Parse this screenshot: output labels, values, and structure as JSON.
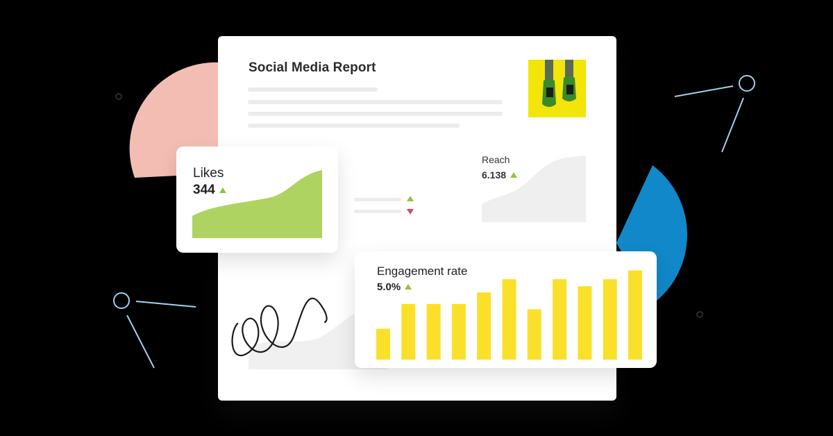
{
  "report": {
    "title": "Social Media Report"
  },
  "reach": {
    "label": "Reach",
    "value": "6.138",
    "trend": "up"
  },
  "likes": {
    "label": "Likes",
    "value": "344",
    "trend": "up"
  },
  "engagement": {
    "label": "Engagement rate",
    "value": "5.0%",
    "trend": "up"
  },
  "colors": {
    "likes_fill": "#aed361",
    "bar_fill": "#fbe02b",
    "trend_up": "#8cc63f",
    "trend_down": "#e0455a",
    "deco_pink": "#f4bdb4",
    "deco_blue": "#1188c9",
    "deco_line": "#9fd3ee"
  },
  "chart_data": {
    "type": "bar",
    "values": [
      3.5,
      6.3,
      6.3,
      6.3,
      7.6,
      9.1,
      5.7,
      9.1,
      8.3,
      9.1,
      10.1
    ],
    "ylim": [
      0,
      11
    ],
    "title": "",
    "xlabel": "",
    "ylabel": ""
  }
}
